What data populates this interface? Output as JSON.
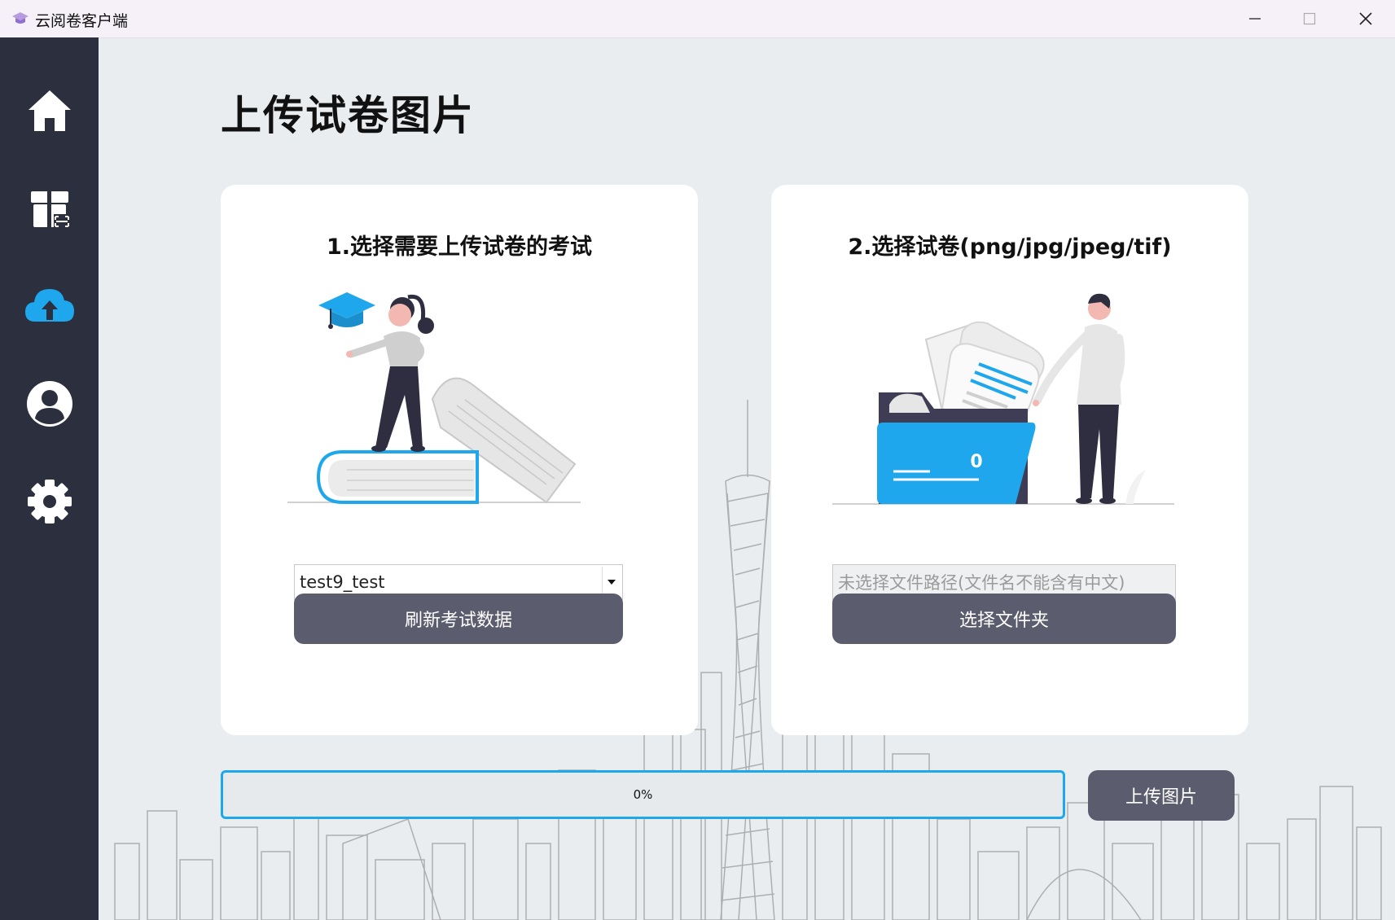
{
  "window": {
    "title": "云阅卷客户端"
  },
  "sidebar": {
    "items": [
      {
        "icon": "home-icon"
      },
      {
        "icon": "exam-package-icon"
      },
      {
        "icon": "cloud-upload-icon",
        "active": true
      },
      {
        "icon": "user-icon"
      },
      {
        "icon": "settings-icon"
      }
    ]
  },
  "page": {
    "title": "上传试卷图片"
  },
  "card_exam": {
    "title": "1.选择需要上传试卷的考试",
    "select_value": "test9_test",
    "refresh_label": "刷新考试数据"
  },
  "card_file": {
    "title": "2.选择试卷(png/jpg/jpeg/tif)",
    "folder_count": "0",
    "path_placeholder": "未选择文件路径(文件名不能含有中文)",
    "path_value": "",
    "choose_label": "选择文件夹"
  },
  "upload": {
    "progress": 0,
    "progress_text": "0%",
    "button_label": "上传图片"
  },
  "colors": {
    "accent": "#1ea7ec",
    "sidebar": "#2c2f3d",
    "button": "#5b5d6f",
    "active_icon": "#1ea7ec"
  }
}
